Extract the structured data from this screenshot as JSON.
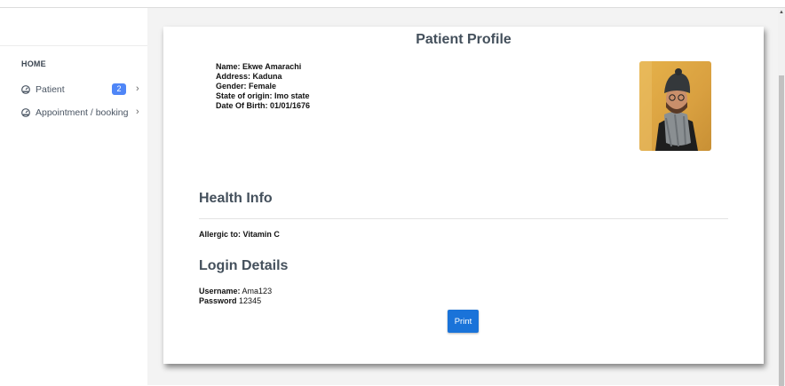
{
  "sidebar": {
    "section": "HOME",
    "items": [
      {
        "label": "Patient",
        "badge": "2",
        "icon": "dashboard-gauge-icon"
      },
      {
        "label": "Appointment / booking",
        "icon": "dashboard-gauge-icon"
      }
    ]
  },
  "profile": {
    "title": "Patient Profile",
    "name": "Name: Ekwe Amarachi",
    "address": "Address: Kaduna",
    "gender": "Gender: Female",
    "state": "State of origin: Imo state",
    "dob": "Date Of Birth: 01/01/1676"
  },
  "health": {
    "heading": "Health Info",
    "allergic": "Allergic to: Vitamin C"
  },
  "login": {
    "heading": "Login Details",
    "username_label": "Username:",
    "username_value": "Ama123",
    "password_label": "Password",
    "password_value": "12345"
  },
  "actions": {
    "print": "Print"
  },
  "colors": {
    "primary": "#1a73d9",
    "badge": "#4f86f7",
    "heading": "#44505c"
  }
}
